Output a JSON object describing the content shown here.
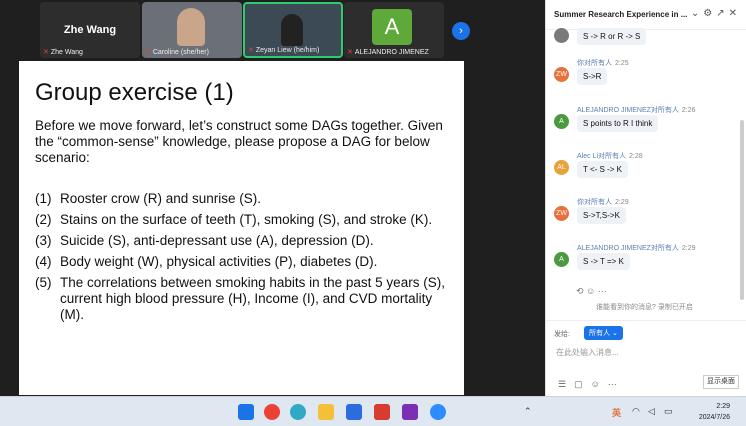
{
  "video": {
    "tiles": [
      {
        "name": "Zhe Wang",
        "label": "Zhe Wang"
      },
      {
        "name": "",
        "label": "Caroline (she/her)"
      },
      {
        "name": "",
        "label": "Zeyan Liew (he/him)"
      },
      {
        "name": "",
        "label": "ALEJANDRO JIMENEZ",
        "avatar_letter": "A"
      }
    ]
  },
  "slide": {
    "title": "Group exercise (1)",
    "intro": "Before we move forward, let’s construct some DAGs together. Given the “common-sense” knowledge, please propose a DAG for below scenario:",
    "items": [
      {
        "num": "(1)",
        "text": "Rooster crow (R) and sunrise (S)."
      },
      {
        "num": "(2)",
        "text": "Stains on the surface of teeth (T), smoking (S), and stroke (K)."
      },
      {
        "num": "(3)",
        "text": "Suicide (S), anti-depressant use (A), depression (D)."
      },
      {
        "num": "(4)",
        "text": "Body weight (W), physical activities (P), diabetes (D)."
      },
      {
        "num": "(5)",
        "text": "The correlations between smoking habits in the past 5 years (S), current high blood pressure (H), Income (I), and CVD mortality (M)."
      }
    ]
  },
  "chat": {
    "title": "Summer Research Experience in ...",
    "messages": [
      {
        "avatar": "",
        "sender": "",
        "time": "",
        "text": "S -> R or R -> S"
      },
      {
        "avatar": "ZW",
        "sender": "你对所有人",
        "time": "2:25",
        "text": "S->R"
      },
      {
        "avatar": "A",
        "sender": "ALEJANDRO JIMENEZ对所有人",
        "time": "2:26",
        "text": "S points to R I think"
      },
      {
        "avatar": "AL",
        "sender": "Alec Li对所有人",
        "time": "2:28",
        "text": "T <- S -> K"
      },
      {
        "avatar": "ZW",
        "sender": "你对所有人",
        "time": "2:29",
        "text": "S->T,S->K"
      },
      {
        "avatar": "A",
        "sender": "ALEJANDRO JIMENEZ对所有人",
        "time": "2:29",
        "text": "S -> T => K"
      }
    ],
    "notice": "谁能看到你的消息? 录制已开启",
    "to_label": "发给:",
    "to_value": "所有人",
    "placeholder": "在此处输入消息...",
    "send_label": "显示桌面"
  },
  "taskbar": {
    "ime": "英",
    "time": "2:29",
    "date": "2024/7/26"
  }
}
